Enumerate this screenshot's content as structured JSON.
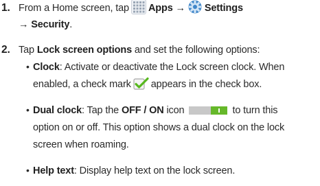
{
  "steps": [
    {
      "number": "1.",
      "line1_pre": "From a Home screen, tap",
      "apps_label": "Apps",
      "arrow1": "→",
      "settings_label": "Settings",
      "line2_arrow": "→",
      "security_label": "Security",
      "line2_end": "."
    },
    {
      "number": "2.",
      "line1_pre": "Tap",
      "lock_options_label": "Lock screen options",
      "line1_post": "and set the following options:"
    }
  ],
  "options": [
    {
      "term": "Clock",
      "line1_rest": ": Activate or deactivate the Lock screen clock. When",
      "line2_pre": "enabled, a check mark",
      "line2_post": "appears in the check box."
    },
    {
      "term": "Dual clock",
      "line1_pre": ": Tap the",
      "toggle_label": "OFF / ON",
      "icon_word": "icon",
      "line1_post": "to turn this",
      "line2": "option on or off. This option shows a dual clock on the lock",
      "line3": "screen when roaming."
    },
    {
      "term": "Help text",
      "line1_rest": ": Display help text on the lock screen."
    }
  ],
  "bullet_glyph": "•",
  "icons": {
    "apps": "apps-grid-icon",
    "settings": "settings-gear-icon",
    "check": "checkmark-icon",
    "toggle": "off-on-toggle-icon"
  },
  "colors": {
    "text": "#2a2a2a",
    "check_green": "#58b81f",
    "toggle_on": "#66b82a",
    "toggle_off": "#c8c8c8",
    "gear_blue": "#3f86c9"
  }
}
